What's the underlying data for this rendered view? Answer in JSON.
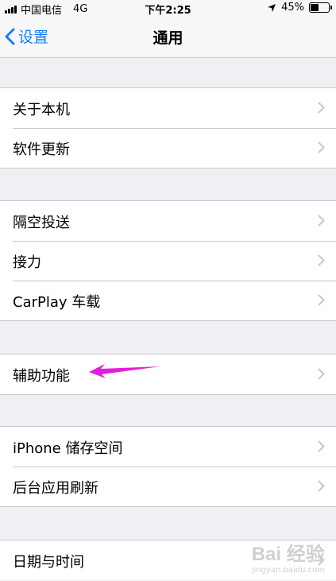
{
  "status_bar": {
    "carrier": "中国电信",
    "network": "4G",
    "time": "下午2:25",
    "battery_percent": "45%",
    "battery_level": 0.45
  },
  "nav": {
    "back_label": "设置",
    "title": "通用"
  },
  "groups": [
    {
      "items": [
        {
          "label": "关于本机"
        },
        {
          "label": "软件更新"
        }
      ]
    },
    {
      "items": [
        {
          "label": "隔空投送"
        },
        {
          "label": "接力"
        },
        {
          "label": "CarPlay 车载"
        }
      ]
    },
    {
      "items": [
        {
          "label": "辅助功能"
        }
      ]
    },
    {
      "items": [
        {
          "label": "iPhone 储存空间"
        },
        {
          "label": "后台应用刷新"
        }
      ]
    },
    {
      "items": [
        {
          "label": "日期与时间"
        }
      ]
    }
  ],
  "annotation": {
    "color": "#e21fd8"
  },
  "watermark": {
    "logo": "Bai 经验",
    "url": "jingyan.baidu.com"
  },
  "colors": {
    "accent": "#147efb",
    "background": "#efeff4",
    "separator": "#c8c7cc"
  }
}
